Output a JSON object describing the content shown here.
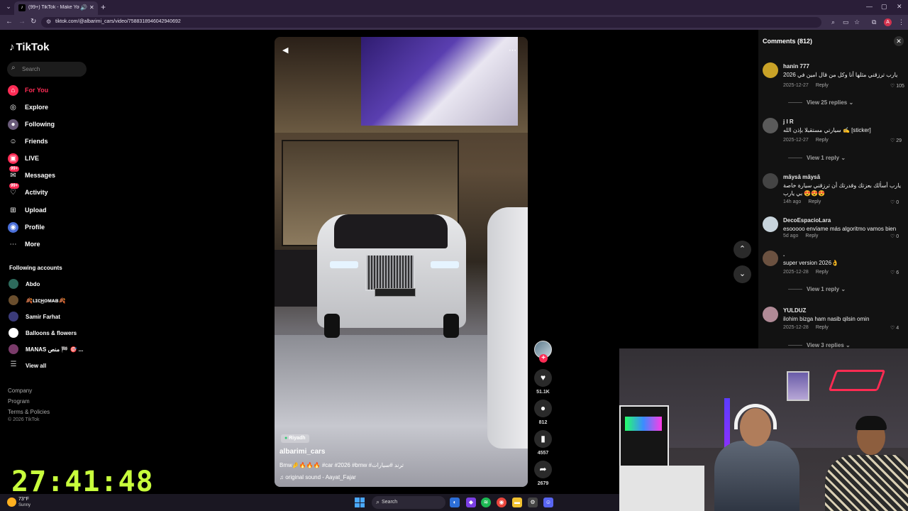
{
  "browser": {
    "tab_title": "(99+) TikTok - Make Your Day",
    "tab_list_glyph": "⌄",
    "new_tab_glyph": "+",
    "url": "tiktok.com/@albarimi_cars/video/7588318946042940692",
    "window_controls": [
      "—",
      "▢",
      "✕"
    ]
  },
  "tiktok": {
    "logo": "TikTok",
    "search_placeholder": "Search",
    "nav": [
      {
        "label": "For You",
        "icon": "home-icon",
        "active": true
      },
      {
        "label": "Explore",
        "icon": "compass-icon"
      },
      {
        "label": "Following",
        "icon": "following-icon"
      },
      {
        "label": "Friends",
        "icon": "friends-icon"
      },
      {
        "label": "LIVE",
        "icon": "live-icon"
      },
      {
        "label": "Messages",
        "icon": "messages-icon",
        "badge": "99+"
      },
      {
        "label": "Activity",
        "icon": "activity-icon",
        "badge": "99+"
      },
      {
        "label": "Upload",
        "icon": "upload-icon"
      },
      {
        "label": "Profile",
        "icon": "profile-icon"
      },
      {
        "label": "More",
        "icon": "more-icon"
      }
    ],
    "following_heading": "Following accounts",
    "following_accounts": [
      {
        "name": "Abdo",
        "color": "#2d6a5c"
      },
      {
        "name": "🍂ʟɪᴄ͜ʜᴏᴍᴀʙ🍂",
        "color": "#6a4e2d"
      },
      {
        "name": "Samir Farhat",
        "color": "#3b3b7a"
      },
      {
        "name": "Balloons & flowers",
        "color": "#ffffff"
      },
      {
        "name": "MANAS منص 🏁 🎯 ...",
        "color": "#7a3b6a"
      }
    ],
    "view_all": "View all",
    "footer_links": [
      "Company",
      "Program",
      "Terms & Policies"
    ],
    "copyright": "© 2026 TikTok"
  },
  "timer": "27:41:48",
  "video": {
    "location": "Riyadh",
    "author": "albarimi_cars",
    "caption": "Bmw🤌🔥🔥🔥 #car #2026 #bmw #ترند #سيارات",
    "sound": "♫ original sound - Aayat_Fajar",
    "likes": "51.1K",
    "comments": "812",
    "saves": "4557",
    "shares": "2679"
  },
  "comments_panel": {
    "title": "Comments",
    "count": "(812)",
    "items": [
      {
        "user": "hanin 777",
        "text": "يارب ترزقني مثلها أنا وكل من قال امين في 2026",
        "date": "2025-12-27",
        "likes": "105",
        "avatar": "#c9a227",
        "replies": "View 25 replies"
      },
      {
        "user": "j I R",
        "text": "سيارتي مستقبلا بإذن الله ✍️ [sticker]",
        "date": "2025-12-27",
        "likes": "29",
        "avatar": "#5a5a5a",
        "replies": "View 1 reply"
      },
      {
        "user": "māysā māysā",
        "text": "يارب أسألك بعزتك وقدرتك أن ترزقني سيارة خاصة بي يارب 😍😍😍",
        "date": "14h ago",
        "likes": "0",
        "avatar": "#444444"
      },
      {
        "user": "DecoEspacioLara",
        "text": "esooooo envíame más algoritmo vamos bien",
        "date": "5d ago",
        "likes": "0",
        "avatar": "#c8d4dc"
      },
      {
        "user": ".",
        "text": "super version 2026👌",
        "date": "2025-12-28",
        "likes": "6",
        "avatar": "#6b5140",
        "replies": "View 1 reply"
      },
      {
        "user": "YULDUZ",
        "text": "ilohim bizga ham nasib qilsin omin",
        "date": "2025-12-28",
        "likes": "4",
        "avatar": "#b08a96",
        "replies": "View 3 replies"
      }
    ],
    "reply_label": "Reply"
  },
  "taskbar": {
    "temperature": "73°F",
    "condition": "Sunny",
    "search_label": "Search"
  }
}
